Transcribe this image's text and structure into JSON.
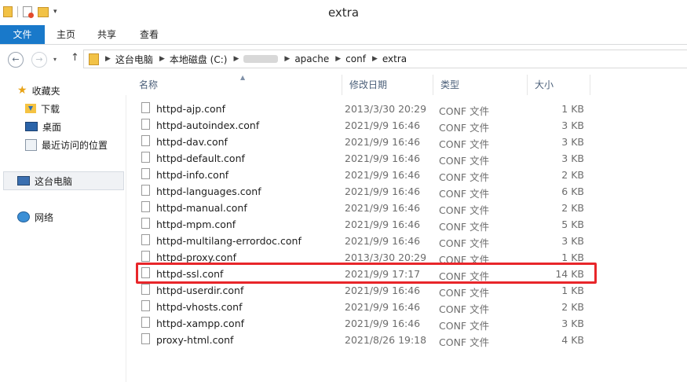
{
  "window": {
    "title": "extra",
    "quick_access_icons": [
      "folder-icon",
      "properties-icon",
      "new-folder-icon",
      "customize-dropdown-icon"
    ]
  },
  "ribbon": {
    "tabs": [
      {
        "label": "文件"
      },
      {
        "label": "主页"
      },
      {
        "label": "共享"
      },
      {
        "label": "查看"
      }
    ]
  },
  "address": {
    "crumbs": [
      "这台电脑",
      "本地磁盘 (C:)",
      "",
      "apache",
      "conf",
      "extra"
    ]
  },
  "sidebar": {
    "favorites": "收藏夹",
    "downloads": "下载",
    "desktop": "桌面",
    "recent": "最近访问的位置",
    "this_pc": "这台电脑",
    "network": "网络"
  },
  "columns": {
    "name": "名称",
    "modified": "修改日期",
    "type": "类型",
    "size": "大小"
  },
  "files": [
    {
      "name": "httpd-ajp.conf",
      "modified": "2013/3/30 20:29",
      "type": "CONF 文件",
      "size": "1 KB"
    },
    {
      "name": "httpd-autoindex.conf",
      "modified": "2021/9/9 16:46",
      "type": "CONF 文件",
      "size": "3 KB"
    },
    {
      "name": "httpd-dav.conf",
      "modified": "2021/9/9 16:46",
      "type": "CONF 文件",
      "size": "3 KB"
    },
    {
      "name": "httpd-default.conf",
      "modified": "2021/9/9 16:46",
      "type": "CONF 文件",
      "size": "3 KB"
    },
    {
      "name": "httpd-info.conf",
      "modified": "2021/9/9 16:46",
      "type": "CONF 文件",
      "size": "2 KB"
    },
    {
      "name": "httpd-languages.conf",
      "modified": "2021/9/9 16:46",
      "type": "CONF 文件",
      "size": "6 KB"
    },
    {
      "name": "httpd-manual.conf",
      "modified": "2021/9/9 16:46",
      "type": "CONF 文件",
      "size": "2 KB"
    },
    {
      "name": "httpd-mpm.conf",
      "modified": "2021/9/9 16:46",
      "type": "CONF 文件",
      "size": "5 KB"
    },
    {
      "name": "httpd-multilang-errordoc.conf",
      "modified": "2021/9/9 16:46",
      "type": "CONF 文件",
      "size": "3 KB"
    },
    {
      "name": "httpd-proxy.conf",
      "modified": "2013/3/30 20:29",
      "type": "CONF 文件",
      "size": "1 KB"
    },
    {
      "name": "httpd-ssl.conf",
      "modified": "2021/9/9 17:17",
      "type": "CONF 文件",
      "size": "14 KB"
    },
    {
      "name": "httpd-userdir.conf",
      "modified": "2021/9/9 16:46",
      "type": "CONF 文件",
      "size": "1 KB"
    },
    {
      "name": "httpd-vhosts.conf",
      "modified": "2021/9/9 16:46",
      "type": "CONF 文件",
      "size": "2 KB"
    },
    {
      "name": "httpd-xampp.conf",
      "modified": "2021/9/9 16:46",
      "type": "CONF 文件",
      "size": "3 KB"
    },
    {
      "name": "proxy-html.conf",
      "modified": "2021/8/26 19:18",
      "type": "CONF 文件",
      "size": "4 KB"
    }
  ],
  "highlight_color": "#e8262a"
}
